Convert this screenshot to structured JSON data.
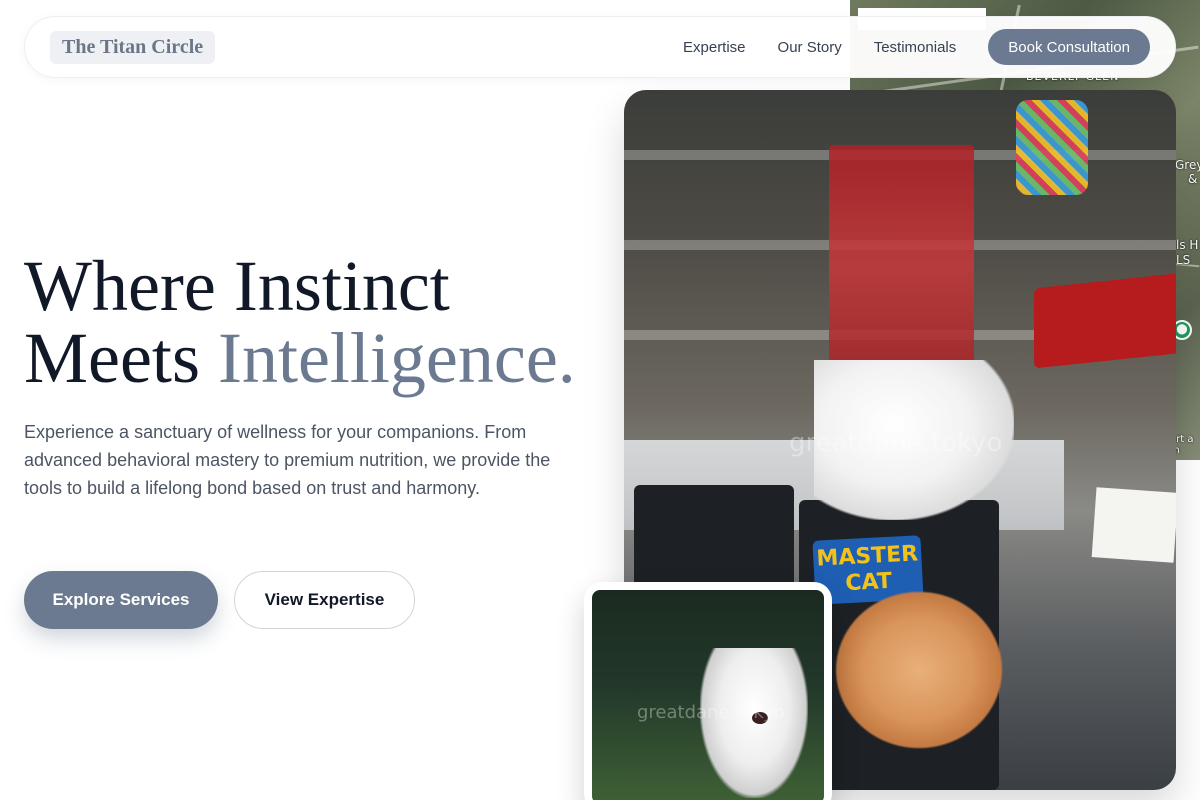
{
  "brand": {
    "name": "The Titan Circle"
  },
  "nav": {
    "links": [
      "Expertise",
      "Our Story",
      "Testimonials"
    ],
    "cta": "Book Consultation"
  },
  "hero": {
    "title_line1": "Where Instinct",
    "title_line2_prefix": "Meets",
    "title_line2_accent": "Intelligence.",
    "description": "Experience a sanctuary of wellness for your companions. From advanced behavioral mastery to premium nutrition, we provide the tools to build a lifelong bond based on trust and harmony.",
    "primary_button": "Explore Services",
    "secondary_button": "View Expertise"
  },
  "images": {
    "main_photo": {
      "sign_text": "MASTER CAT",
      "watermark": "greatdane.tokyo"
    },
    "dog_photo": {
      "watermark": "greatdane.tokyo"
    }
  },
  "map": {
    "labels": [
      "BEVERLY GLEN",
      "Grey",
      "&",
      "ls H",
      "LS",
      "ort a m"
    ]
  },
  "colors": {
    "accent": "#6b7a90",
    "text_dark": "#111827",
    "text_muted": "#4b5563"
  }
}
